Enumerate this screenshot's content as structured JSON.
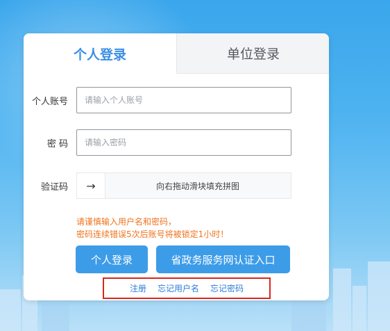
{
  "tabs": {
    "personal": "个人登录",
    "company": "单位登录"
  },
  "form": {
    "account_label": "个人账号",
    "account_placeholder": "请输入个人账号",
    "password_label": "密 码",
    "password_placeholder": "请输入密码",
    "captcha_label": "验证码",
    "slider_hint": "向右拖动滑块填充拼图",
    "slider_arrow": "→"
  },
  "warning": {
    "line1": "请谨慎输入用户名和密码，",
    "line2": "密码连续错误5次后账号将被锁定1小时！"
  },
  "buttons": {
    "personal_login": "个人登录",
    "province_auth": "省政务服务网认证入口"
  },
  "links": {
    "register": "注册",
    "forgot_username": "忘记用户名",
    "forgot_password": "忘记密码"
  },
  "colors": {
    "accent": "#3a8ee6",
    "button": "#3d9ce8",
    "warning": "#f0731d",
    "highlight_box": "#d9261c"
  }
}
